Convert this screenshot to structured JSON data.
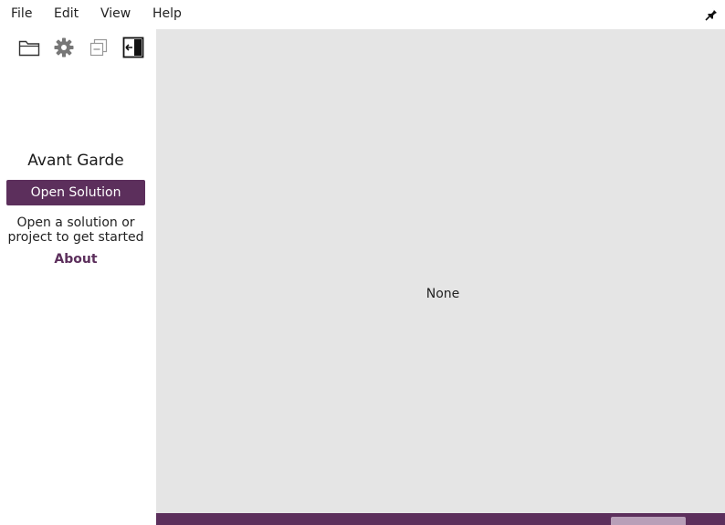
{
  "menu": {
    "file": "File",
    "edit": "Edit",
    "view": "View",
    "help": "Help"
  },
  "toolbar": {
    "icons": [
      "folder-icon",
      "gear-icon",
      "collapse-all-icon",
      "hide-sidebar-icon"
    ]
  },
  "sidebar": {
    "title": "Avant Garde",
    "open_button": "Open Solution",
    "hint": "Open a solution or project to get started",
    "about_link": "About"
  },
  "main": {
    "content_label": "None"
  },
  "colors": {
    "accent": "#5c2f5c",
    "main_background": "#e5e5e5",
    "status_field": "#b89fb8"
  }
}
